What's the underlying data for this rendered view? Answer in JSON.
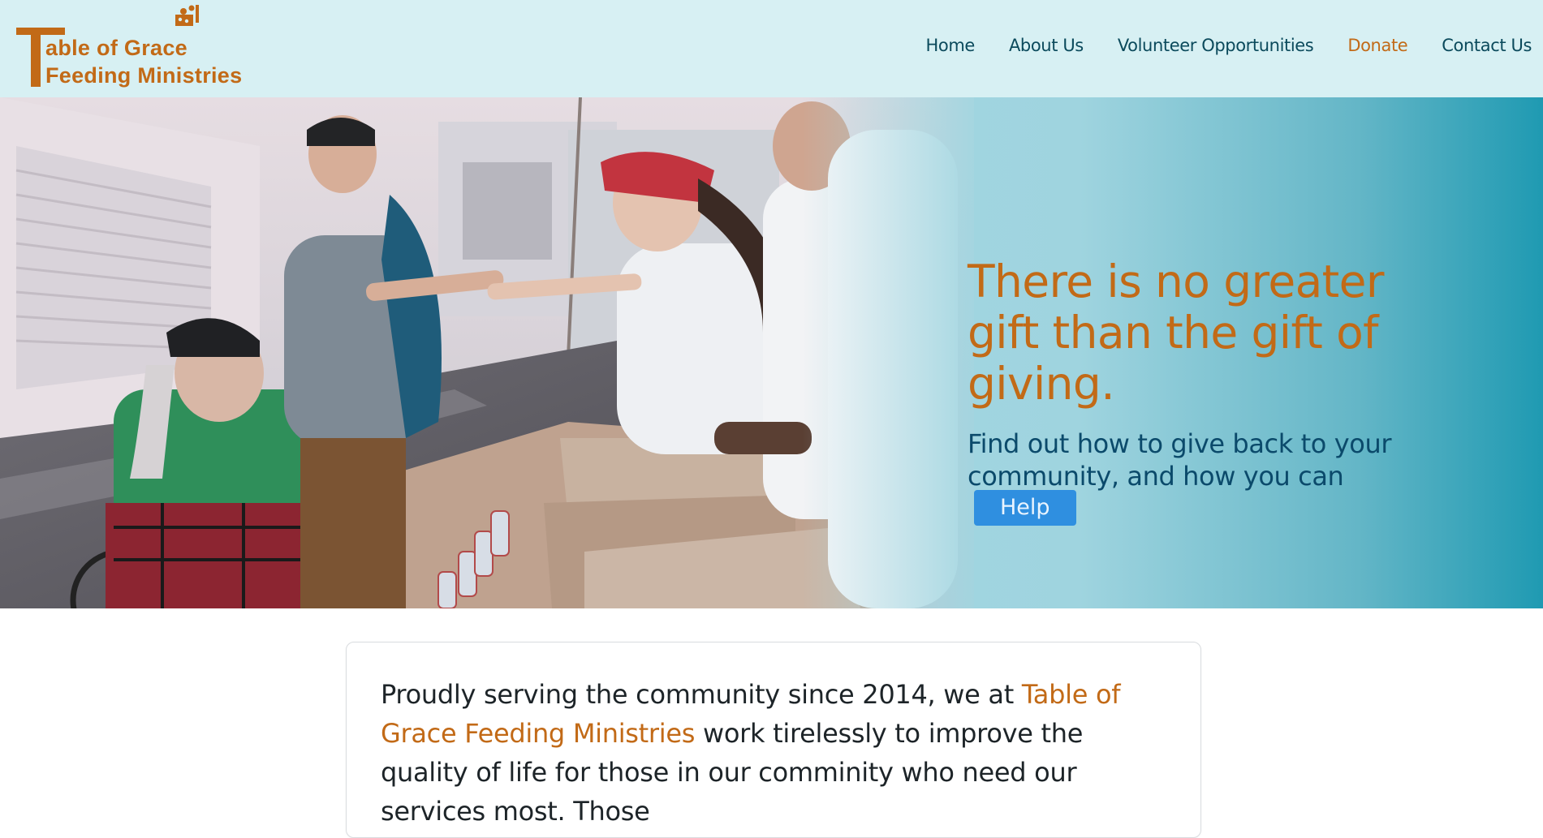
{
  "brand": {
    "line1": "able of Grace",
    "line2": "Feeding Ministries",
    "color": "#c26a17"
  },
  "nav": {
    "items": [
      {
        "label": "Home",
        "active": false
      },
      {
        "label": "About Us",
        "active": false
      },
      {
        "label": "Volunteer Opportunities",
        "active": false
      },
      {
        "label": "Donate",
        "active": true
      },
      {
        "label": "Contact Us",
        "active": false
      }
    ]
  },
  "hero": {
    "title": "There is no greater gift than the gift of giving.",
    "subtitle": "Find out how to give back to your community, and how you can",
    "button_label": "Help",
    "image_description_icon": "volunteers-photo"
  },
  "intro": {
    "text_before": "Proudly serving the community since 2014, we at ",
    "org_name": "Table of Grace Feeding Ministries",
    "text_after": " work tirelessly to improve the quality of life for those in our comminity who need our services most. Those"
  },
  "colors": {
    "header_bg": "#d7f0f3",
    "accent": "#c26a17",
    "nav_text": "#0b4a5c",
    "button": "#2f8fe0"
  }
}
